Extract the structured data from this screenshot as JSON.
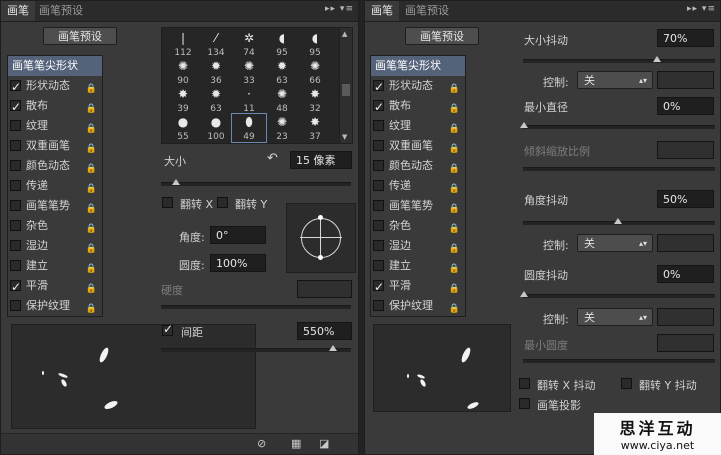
{
  "tabs": {
    "brush": "画笔",
    "brush_presets": "画笔预设"
  },
  "tab_icons": "▸▸ ▾≡",
  "presets_button": "画笔预设",
  "options": [
    {
      "label": "画笔笔尖形状",
      "checked": null
    },
    {
      "label": "形状动态",
      "checked": true
    },
    {
      "label": "散布",
      "checked": true
    },
    {
      "label": "纹理",
      "checked": false
    },
    {
      "label": "双重画笔",
      "checked": false
    },
    {
      "label": "颜色动态",
      "checked": false
    },
    {
      "label": "传递",
      "checked": false
    },
    {
      "label": "画笔笔势",
      "checked": false
    },
    {
      "label": "杂色",
      "checked": false
    },
    {
      "label": "湿边",
      "checked": false
    },
    {
      "label": "建立",
      "checked": false
    },
    {
      "label": "平滑",
      "checked": true
    },
    {
      "label": "保护纹理",
      "checked": false
    }
  ],
  "lock_icon": "🔒",
  "brush_tips": {
    "row0": [
      "112",
      "134",
      "74",
      "95",
      "95"
    ],
    "row1": [
      "90",
      "36",
      "33",
      "63",
      "66"
    ],
    "row2": [
      "39",
      "63",
      "11",
      "48",
      "32"
    ],
    "row3": [
      "55",
      "100",
      "49",
      "23",
      "37"
    ]
  },
  "tip_shapes": {
    "row0": [
      "❘",
      "⁄",
      "✲",
      "◖",
      "◖"
    ],
    "row1": [
      "✺",
      "✹",
      "✺",
      "✹",
      "✺"
    ],
    "row2": [
      "✸",
      "✹",
      "·",
      "✺",
      "✸"
    ],
    "row3": [
      "●",
      "●",
      "⬮",
      "✺",
      "✸"
    ]
  },
  "tip_panel": {
    "size_label": "大小",
    "size_value": "15 像素",
    "flip_x": "翻转 X",
    "flip_y": "翻转 Y",
    "angle_label": "角度:",
    "angle_value": "0°",
    "roundness_label": "圆度:",
    "roundness_value": "100%",
    "hardness_label": "硬度",
    "spacing_label": "间距",
    "spacing_value": "550%",
    "spacing_checked": true
  },
  "shape_dynamics": {
    "size_jitter_label": "大小抖动",
    "size_jitter_value": "70%",
    "control_label": "控制:",
    "control_value": "关",
    "min_diameter_label": "最小直径",
    "min_diameter_value": "0%",
    "tilt_scale_label": "倾斜缩放比例",
    "angle_jitter_label": "角度抖动",
    "angle_jitter_value": "50%",
    "roundness_jitter_label": "圆度抖动",
    "roundness_jitter_value": "0%",
    "min_roundness_label": "最小圆度",
    "flip_x_jitter": "翻转 X 抖动",
    "flip_y_jitter": "翻转 Y 抖动",
    "brush_projection": "画笔投影"
  },
  "watermark": {
    "title": "思洋互动",
    "url": "www.ciya.net"
  },
  "bottom_icons": [
    "brush-visibility-icon",
    "grid-icon",
    "new-preset-icon"
  ]
}
